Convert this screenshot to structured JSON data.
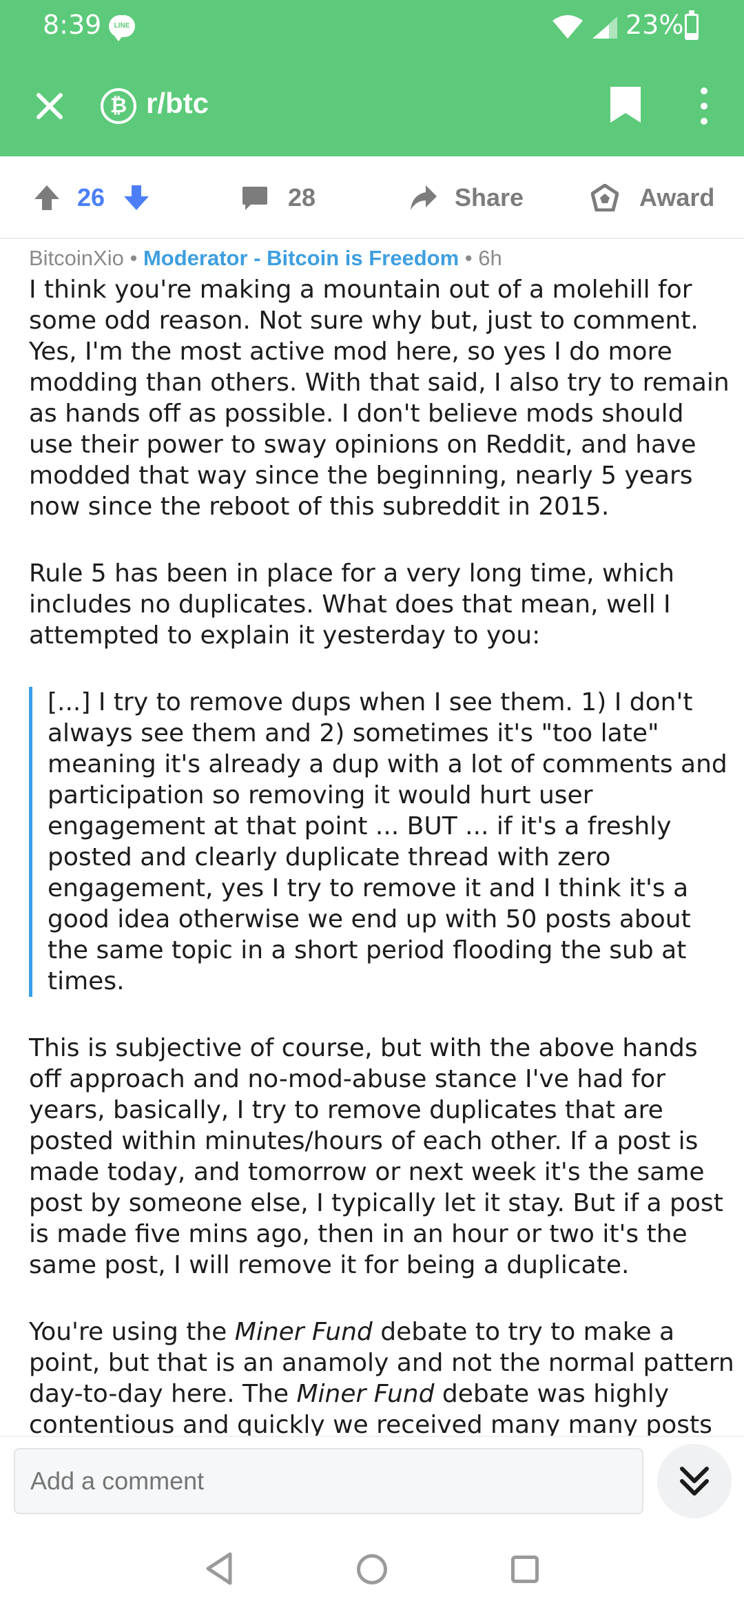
{
  "status_bar": {
    "time": "8:39",
    "app_icon": "line-icon",
    "app_icon_text": "LINE",
    "battery_percent": "23%",
    "battery_level": 0.23
  },
  "app_bar": {
    "subreddit": "r/btc",
    "subreddit_icon": "bitcoin-icon",
    "subreddit_icon_glyph": "₿"
  },
  "actions": {
    "score": "26",
    "comment_count": "28",
    "share_label": "Share",
    "award_label": "Award"
  },
  "comment": {
    "author": "BitcoinXio",
    "separator": "•",
    "flair": "Moderator - Bitcoin is Freedom",
    "age": "6h",
    "paragraph_1": "I think you're making a mountain out of a molehill for some odd reason. Not sure why but, just to comment. Yes, I'm the most active mod here, so yes I do more modding than others. With that said, I also try to remain as hands off as possible. I don't believe mods should use their power to sway opinions on Reddit, and have modded that way since the beginning, nearly 5 years now since the reboot of this subreddit in 2015.",
    "paragraph_2": "Rule 5 has been in place for a very long time, which includes no duplicates. What does that mean, well I attempted to explain it yesterday to you:",
    "quote": "[...] I try to remove dups when I see them. 1) I don't always see them and 2) sometimes it's \"too late\" meaning it's already a dup with a lot of comments and participation so removing it would hurt user engagement at that point ... BUT ... if it's a freshly posted and clearly duplicate thread with zero engagement, yes I try to remove it and I think it's a good idea otherwise we end up with 50 posts about the same topic in a short period flooding the sub at times.",
    "paragraph_3": "This is subjective of course, but with the above hands off approach and no-mod-abuse stance I've had for years, basically, I try to remove duplicates that are posted within minutes/hours of each other. If a post is made today, and tomorrow or next week it's the same post by someone else, I typically let it stay. But if a post is made five mins ago, then in an hour or two it's the same post, I will remove it for being a duplicate.",
    "paragraph_4_a": "You're using the ",
    "paragraph_4_em1": "Miner Fund",
    "paragraph_4_b": " debate to try to make a point, but that is an anamoly and not the normal pattern day-to-day here. The ",
    "paragraph_4_em2": "Miner Fund",
    "paragraph_4_c": " debate was highly contentious and quickly we received many many posts about it. So much so, that in the same vein as 'no"
  },
  "composer": {
    "placeholder": "Add a comment"
  },
  "colors": {
    "header_green": "#5cca7a",
    "score_blue": "#4c7ff7",
    "flair_blue": "#3e9fe0",
    "quote_bar": "#3a9ee8"
  }
}
